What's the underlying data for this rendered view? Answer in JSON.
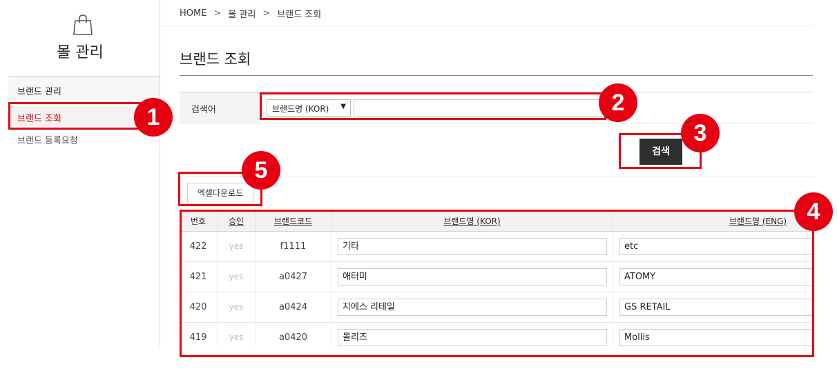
{
  "sidebar": {
    "icon": "shopping-bag-icon",
    "title": "몰 관리",
    "group_label": "브랜드 관리",
    "items": [
      {
        "label": "브랜드 조회",
        "active": true
      },
      {
        "label": "브랜드 등록요청",
        "active": false
      }
    ]
  },
  "breadcrumb": {
    "separator": ">",
    "items": [
      "HOME",
      "몰 관리",
      "브랜드 조회"
    ]
  },
  "page": {
    "title": "브랜드 조회"
  },
  "search": {
    "label": "검색어",
    "select_value": "브랜드명 (KOR)",
    "select_caret": "▼",
    "input_value": "",
    "button_label": "검색"
  },
  "excel": {
    "button_label": "엑셀다운로드"
  },
  "table": {
    "headers": [
      "번호",
      "승인",
      "브랜드코드",
      "브랜드명 (KOR)",
      "브랜드명 (ENG)"
    ],
    "rows": [
      {
        "num": "422",
        "approved": "yes",
        "code": "f1111",
        "name_kor": "기타",
        "name_eng": "etc"
      },
      {
        "num": "421",
        "approved": "yes",
        "code": "a0427",
        "name_kor": "애터미",
        "name_eng": "ATOMY"
      },
      {
        "num": "420",
        "approved": "yes",
        "code": "a0424",
        "name_kor": "지에스 리테일",
        "name_eng": "GS RETAIL"
      },
      {
        "num": "419",
        "approved": "yes",
        "code": "a0420",
        "name_kor": "몰리즈",
        "name_eng": "Mollis"
      }
    ]
  },
  "annotations": {
    "color": "#e60012",
    "badges": [
      "1",
      "2",
      "3",
      "4",
      "5"
    ]
  }
}
